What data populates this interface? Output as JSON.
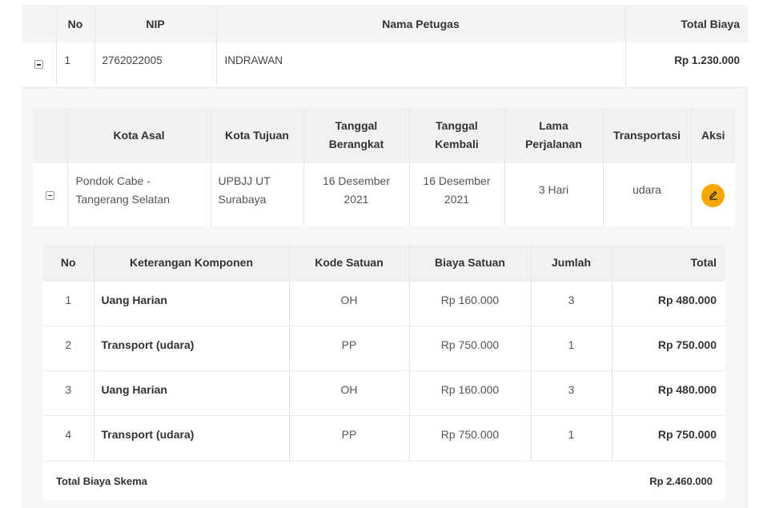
{
  "main_table": {
    "headers": [
      "No",
      "NIP",
      "Nama Petugas",
      "Total Biaya"
    ],
    "row": {
      "no": "1",
      "nip": "2762022005",
      "nama": "INDRAWAN",
      "total_biaya": "Rp 1.230.000"
    }
  },
  "trip_table": {
    "headers": {
      "kota_asal": "Kota Asal",
      "kota_tujuan": "Kota Tujuan",
      "tanggal_berangkat_1": "Tanggal",
      "tanggal_berangkat_2": "Berangkat",
      "tanggal_kembali_1": "Tanggal",
      "tanggal_kembali_2": "Kembali",
      "lama_1": "Lama",
      "lama_2": "Perjalanan",
      "transportasi": "Transportasi",
      "aksi": "Aksi"
    },
    "row": {
      "kota_asal_1": "Pondok Cabe -",
      "kota_asal_2": "Tangerang Selatan",
      "kota_tujuan_1": "UPBJJ UT",
      "kota_tujuan_2": "Surabaya",
      "berangkat_1": "16 Desember",
      "berangkat_2": "2021",
      "kembali_1": "16 Desember",
      "kembali_2": "2021",
      "lama": "3 Hari",
      "transportasi": "udara"
    },
    "edit_icon": "pencil-icon",
    "accent_color": "#f6a800"
  },
  "component_table": {
    "headers": [
      "No",
      "Keterangan Komponen",
      "Kode Satuan",
      "Biaya Satuan",
      "Jumlah",
      "Total"
    ],
    "rows": [
      {
        "no": "1",
        "keterangan": "Uang Harian",
        "kode": "OH",
        "biaya": "Rp 160.000",
        "jumlah": "3",
        "total": "Rp 480.000"
      },
      {
        "no": "2",
        "keterangan": "Transport (udara)",
        "kode": "PP",
        "biaya": "Rp 750.000",
        "jumlah": "1",
        "total": "Rp 750.000"
      },
      {
        "no": "3",
        "keterangan": "Uang Harian",
        "kode": "OH",
        "biaya": "Rp 160.000",
        "jumlah": "3",
        "total": "Rp 480.000"
      },
      {
        "no": "4",
        "keterangan": "Transport (udara)",
        "kode": "PP",
        "biaya": "Rp 750.000",
        "jumlah": "1",
        "total": "Rp 750.000"
      }
    ],
    "summary_label": "Total Biaya Skema",
    "summary_value": "Rp 2.460.000"
  }
}
